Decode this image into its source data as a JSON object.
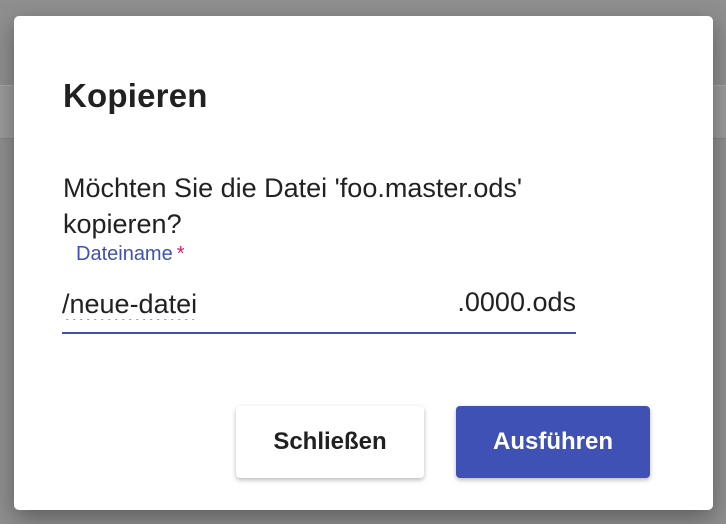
{
  "dialog": {
    "title": "Kopieren",
    "message": "Möchten Sie die Datei 'foo.master.ods' kopieren?",
    "field": {
      "label": "Dateiname",
      "required_marker": "*",
      "value": "/neue-datei",
      "suffix": ".0000.ods"
    },
    "buttons": {
      "close_label": "Schließen",
      "run_label": "Ausführen"
    }
  },
  "colors": {
    "accent": "#3f51b5",
    "required": "#e91e63",
    "spellcheck": "#e53935"
  }
}
